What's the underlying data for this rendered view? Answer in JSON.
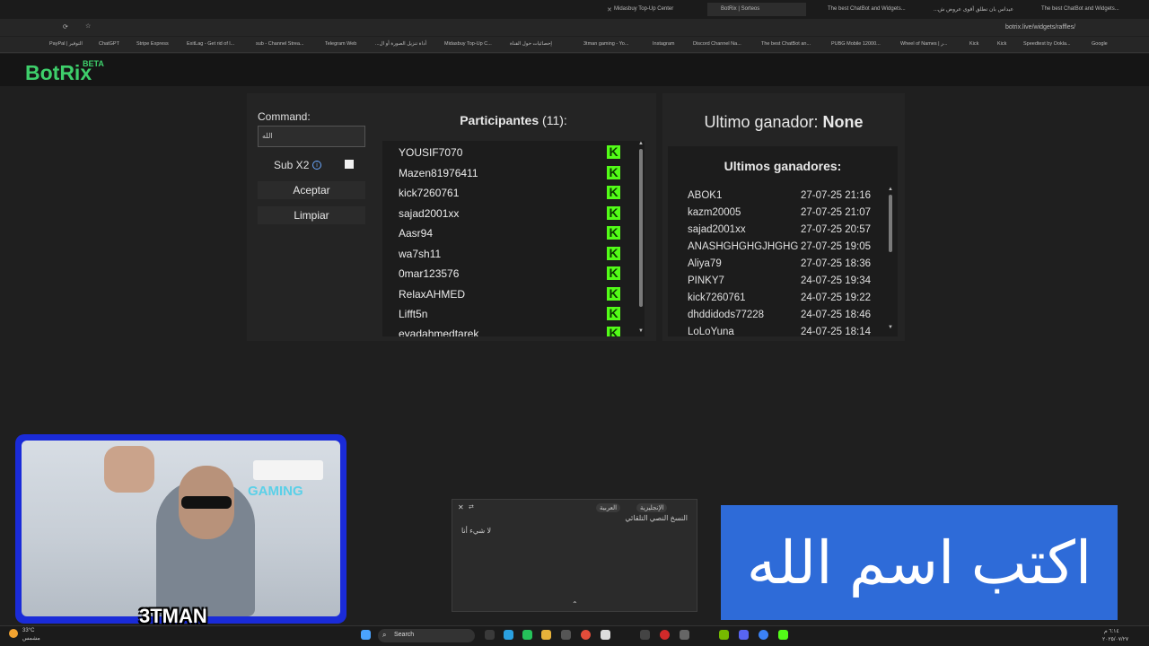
{
  "browser": {
    "tabs": [
      "Midasbuy Top-Up Center",
      "BotRix | Sorteos",
      "The best ChatBot and Widgets...",
      "عيداس بان تطلق أقوى عروض ش...",
      "The best ChatBot and Widgets..."
    ],
    "url": "botrix.live/widgets/raffles/",
    "bookmarks": [
      "PayPal | التوفير",
      "ChatGPT",
      "Stripe Express",
      "ExitLag - Get rid of l...",
      "sub - Channel Strea...",
      "Telegram Web",
      "أداة تنزيل الصورة أو ال...",
      "Midasbuy Top-Up C...",
      "إحصائيات حول القناة",
      "3tman gaming - Yo...",
      "Instagram",
      "Discord Channel Na...",
      "The best ChatBot an...",
      "PUBG Mobile 12000...",
      "Wheel of Names | ر...",
      "Kick",
      "Kick",
      "Speedtest by Ookla...",
      "Google"
    ]
  },
  "site": {
    "logo": "BotRix",
    "beta": "BETA"
  },
  "raffle": {
    "command_label": "Command:",
    "command_value": "الله",
    "subx2_label": "Sub X2",
    "accept_label": "Aceptar",
    "clear_label": "Limpiar"
  },
  "participants": {
    "title": "Participantes",
    "count": "(11):",
    "list": [
      "YOUSIF7070",
      "Mazen81976411",
      "kick7260761",
      "sajad2001xx",
      "Aasr94",
      "wa7sh11",
      "0mar123576",
      "RelaxAHMED",
      "Lifft5n",
      "eyadahmedtarek"
    ]
  },
  "winner": {
    "label": "Ultimo ganador:",
    "value": "None",
    "recent_title": "Ultimos ganadores:",
    "recent": [
      {
        "name": "ABOK1",
        "date": "27-07-25 21:16"
      },
      {
        "name": "kazm20005",
        "date": "27-07-25 21:07"
      },
      {
        "name": "sajad2001xx",
        "date": "27-07-25 20:57"
      },
      {
        "name": "ANASHGHGHGJHGHG",
        "date": "27-07-25 19:05"
      },
      {
        "name": "Aliya79",
        "date": "27-07-25 18:36"
      },
      {
        "name": "PINKY7",
        "date": "24-07-25 19:34"
      },
      {
        "name": "kick7260761",
        "date": "24-07-25 19:22"
      },
      {
        "name": "dhddidods77228",
        "date": "24-07-25 18:46"
      },
      {
        "name": "LoLoYuna",
        "date": "24-07-25 18:14"
      }
    ]
  },
  "webcam": {
    "name": "3TMAN",
    "sign": "GAMING"
  },
  "translate": {
    "source_lang": "العربية",
    "target_lang": "الإنجليزية",
    "heading": "النسخ النصي التلقائي",
    "text": "لا شيء أنا"
  },
  "banner": {
    "text": "اكتب اسم الله"
  },
  "taskbar": {
    "search": "Search",
    "temp": "33°C",
    "weather": "مشمس",
    "time": "٦:١٤ م",
    "date": "٢٠٢٥/٠٧/٢٧"
  }
}
